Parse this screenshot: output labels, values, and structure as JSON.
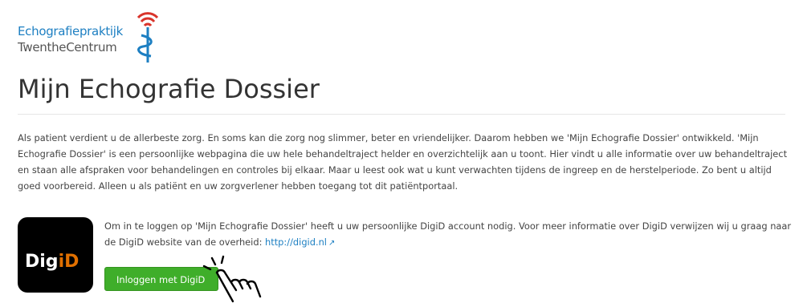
{
  "logo": {
    "line1": "Echografiepraktijk",
    "line2": "TwentheCentrum"
  },
  "page": {
    "title": "Mijn Echografie Dossier"
  },
  "intro": "Als patient verdient u de allerbeste zorg. En soms kan die zorg nog slimmer, beter en vriendelijker. Daarom hebben we 'Mijn Echografie Dossier' ontwikkeld. 'Mijn Echografie Dossier' is een persoonlijke webpagina die uw hele behandeltraject helder en overzichtelijk aan u toont. Hier vindt u alle informatie over uw behandeltraject en staan alle afspraken voor behandelingen en controles bij elkaar. Maar u leest ook wat u kunt verwachten tijdens de ingreep en de herstelperiode. Zo bent u altijd goed voorbereid. Alleen u als patiënt en uw zorgverlener hebben toegang tot dit patiëntportaal.",
  "digid": {
    "logo_text_left": "Dig",
    "logo_text_right": "iD",
    "info": "Om in te loggen op 'Mijn Echografie Dossier' heeft u uw persoonlijke DigiD account nodig. Voor meer informatie over DigiD verwijzen wij u graag naar de DigiD website van de overheid: ",
    "link": "http://digid.nl",
    "link_icon": "external-link-icon",
    "button_label": "Inloggen met DigiD"
  },
  "colors": {
    "brand_blue": "#1d7fc2",
    "button_green": "#3fae2a",
    "digid_orange": "#e17000",
    "logo_red": "#d9342b"
  }
}
